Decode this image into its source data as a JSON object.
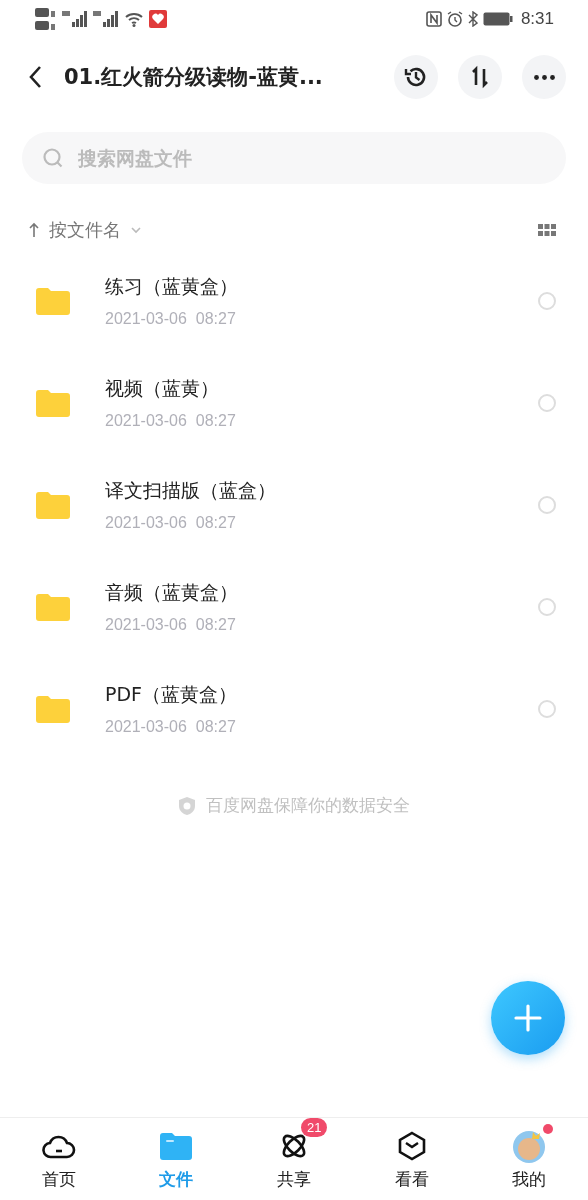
{
  "status_bar": {
    "time": "8:31"
  },
  "header": {
    "title": "01.红火箭分级读物-蓝黄..."
  },
  "search": {
    "placeholder": "搜索网盘文件"
  },
  "sort": {
    "label": "按文件名"
  },
  "files": [
    {
      "name": "练习（蓝黄盒）",
      "date": "2021-03-06  08:27",
      "selected": false
    },
    {
      "name": "视频（蓝黄）",
      "date": "2021-03-06  08:27",
      "selected": false
    },
    {
      "name": "译文扫描版（蓝盒）",
      "date": "2021-03-06  08:27",
      "selected": false
    },
    {
      "name": "音频（蓝黄盒）",
      "date": "2021-03-06  08:27",
      "selected": false
    },
    {
      "name": "PDF（蓝黄盒）",
      "date": "2021-03-06  08:27",
      "selected": false
    }
  ],
  "footer_note": "百度网盘保障你的数据安全",
  "tabs": [
    {
      "kind": "home",
      "label": "首页",
      "selected": false
    },
    {
      "kind": "files",
      "label": "文件",
      "selected": true
    },
    {
      "kind": "share",
      "label": "共享",
      "selected": false,
      "badge": "21"
    },
    {
      "kind": "discover",
      "label": "看看",
      "selected": false
    },
    {
      "kind": "profile",
      "label": "我的",
      "selected": false,
      "dot": true
    }
  ]
}
